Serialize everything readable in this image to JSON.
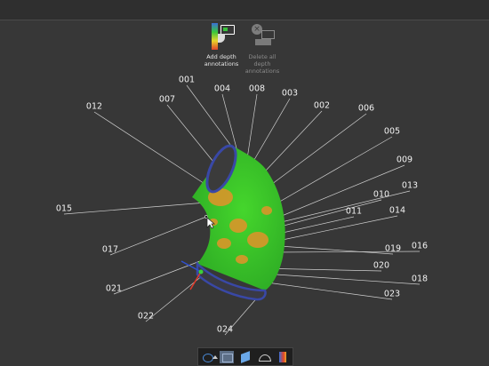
{
  "ribbon": {
    "add_depth": {
      "label": "Add depth\nannotations",
      "icon": "depth-annotation-icon"
    },
    "delete_all": {
      "label": "Delete all\ndepth\nannotations",
      "icon": "delete-annotations-icon"
    }
  },
  "annotations": [
    "001",
    "002",
    "003",
    "004",
    "005",
    "006",
    "007",
    "008",
    "009",
    "010",
    "011",
    "012",
    "013",
    "014",
    "015",
    "016",
    "017",
    "018",
    "019",
    "020",
    "021",
    "022",
    "023",
    "024"
  ],
  "toolbar": {
    "items": [
      "view-cube-icon",
      "perspective-icon",
      "plane-icon",
      "visibility-icon",
      "colormap-icon"
    ]
  },
  "colors": {
    "background": "#373737",
    "surface_green": "#3ecf2a",
    "hotspot_orange": "#d89a2a",
    "rim_blue": "#3a4aa8"
  }
}
